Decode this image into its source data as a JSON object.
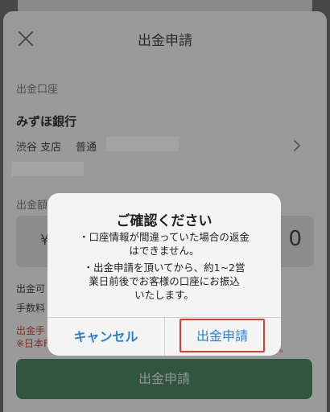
{
  "header": {
    "title": "出金申請"
  },
  "account": {
    "section_label": "出金口座",
    "bank_name": "みずほ銀行",
    "branch": "渋谷 支店",
    "account_type": "普通"
  },
  "amount": {
    "section_label": "出金額",
    "currency_symbol": "¥",
    "value_visible": "0"
  },
  "info": {
    "available_label": "出金可",
    "fee_label": "手数料",
    "notice_red_1": "出金手",
    "notice_red_2": "※日本F",
    "notice_red_tail": "。"
  },
  "submit_label": "出金申請",
  "dialog": {
    "title": "ご確認ください",
    "message_lines_1": [
      "・口座情報が間違っていた場合の返金",
      "はできません。"
    ],
    "message_lines_2": [
      "・出金申請を頂いてから、約1~2営",
      "業日前後でお客様の口座にお振込",
      "いたします。"
    ],
    "cancel_label": "キャンセル",
    "confirm_label": "出金申請"
  },
  "colors": {
    "primary_green": "#4f8565",
    "ios_blue": "#2a7fd8",
    "warning_red": "#c84a3a",
    "highlight_border": "#e0392b"
  }
}
